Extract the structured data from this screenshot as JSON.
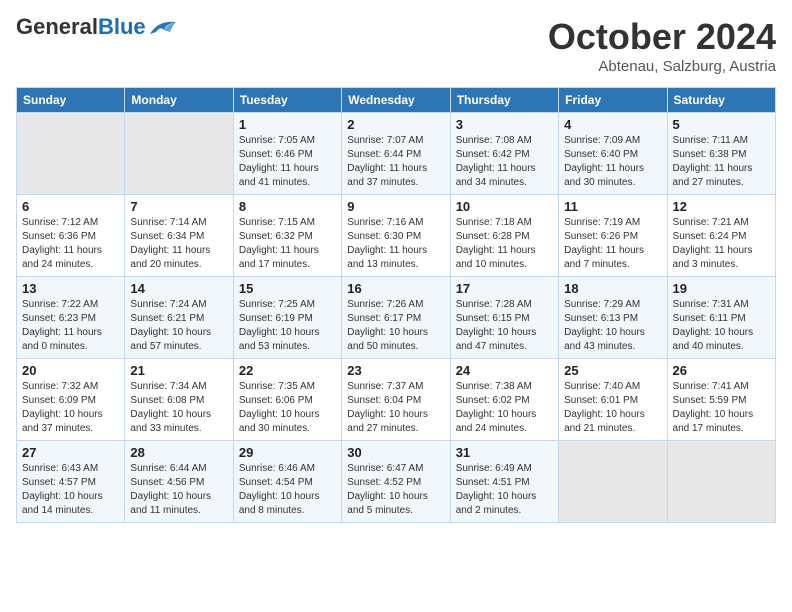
{
  "header": {
    "logo_general": "General",
    "logo_blue": "Blue",
    "title": "October 2024",
    "subtitle": "Abtenau, Salzburg, Austria"
  },
  "weekdays": [
    "Sunday",
    "Monday",
    "Tuesday",
    "Wednesday",
    "Thursday",
    "Friday",
    "Saturday"
  ],
  "weeks": [
    [
      {
        "day": "",
        "info": ""
      },
      {
        "day": "",
        "info": ""
      },
      {
        "day": "1",
        "info": "Sunrise: 7:05 AM\nSunset: 6:46 PM\nDaylight: 11 hours and 41 minutes."
      },
      {
        "day": "2",
        "info": "Sunrise: 7:07 AM\nSunset: 6:44 PM\nDaylight: 11 hours and 37 minutes."
      },
      {
        "day": "3",
        "info": "Sunrise: 7:08 AM\nSunset: 6:42 PM\nDaylight: 11 hours and 34 minutes."
      },
      {
        "day": "4",
        "info": "Sunrise: 7:09 AM\nSunset: 6:40 PM\nDaylight: 11 hours and 30 minutes."
      },
      {
        "day": "5",
        "info": "Sunrise: 7:11 AM\nSunset: 6:38 PM\nDaylight: 11 hours and 27 minutes."
      }
    ],
    [
      {
        "day": "6",
        "info": "Sunrise: 7:12 AM\nSunset: 6:36 PM\nDaylight: 11 hours and 24 minutes."
      },
      {
        "day": "7",
        "info": "Sunrise: 7:14 AM\nSunset: 6:34 PM\nDaylight: 11 hours and 20 minutes."
      },
      {
        "day": "8",
        "info": "Sunrise: 7:15 AM\nSunset: 6:32 PM\nDaylight: 11 hours and 17 minutes."
      },
      {
        "day": "9",
        "info": "Sunrise: 7:16 AM\nSunset: 6:30 PM\nDaylight: 11 hours and 13 minutes."
      },
      {
        "day": "10",
        "info": "Sunrise: 7:18 AM\nSunset: 6:28 PM\nDaylight: 11 hours and 10 minutes."
      },
      {
        "day": "11",
        "info": "Sunrise: 7:19 AM\nSunset: 6:26 PM\nDaylight: 11 hours and 7 minutes."
      },
      {
        "day": "12",
        "info": "Sunrise: 7:21 AM\nSunset: 6:24 PM\nDaylight: 11 hours and 3 minutes."
      }
    ],
    [
      {
        "day": "13",
        "info": "Sunrise: 7:22 AM\nSunset: 6:23 PM\nDaylight: 11 hours and 0 minutes."
      },
      {
        "day": "14",
        "info": "Sunrise: 7:24 AM\nSunset: 6:21 PM\nDaylight: 10 hours and 57 minutes."
      },
      {
        "day": "15",
        "info": "Sunrise: 7:25 AM\nSunset: 6:19 PM\nDaylight: 10 hours and 53 minutes."
      },
      {
        "day": "16",
        "info": "Sunrise: 7:26 AM\nSunset: 6:17 PM\nDaylight: 10 hours and 50 minutes."
      },
      {
        "day": "17",
        "info": "Sunrise: 7:28 AM\nSunset: 6:15 PM\nDaylight: 10 hours and 47 minutes."
      },
      {
        "day": "18",
        "info": "Sunrise: 7:29 AM\nSunset: 6:13 PM\nDaylight: 10 hours and 43 minutes."
      },
      {
        "day": "19",
        "info": "Sunrise: 7:31 AM\nSunset: 6:11 PM\nDaylight: 10 hours and 40 minutes."
      }
    ],
    [
      {
        "day": "20",
        "info": "Sunrise: 7:32 AM\nSunset: 6:09 PM\nDaylight: 10 hours and 37 minutes."
      },
      {
        "day": "21",
        "info": "Sunrise: 7:34 AM\nSunset: 6:08 PM\nDaylight: 10 hours and 33 minutes."
      },
      {
        "day": "22",
        "info": "Sunrise: 7:35 AM\nSunset: 6:06 PM\nDaylight: 10 hours and 30 minutes."
      },
      {
        "day": "23",
        "info": "Sunrise: 7:37 AM\nSunset: 6:04 PM\nDaylight: 10 hours and 27 minutes."
      },
      {
        "day": "24",
        "info": "Sunrise: 7:38 AM\nSunset: 6:02 PM\nDaylight: 10 hours and 24 minutes."
      },
      {
        "day": "25",
        "info": "Sunrise: 7:40 AM\nSunset: 6:01 PM\nDaylight: 10 hours and 21 minutes."
      },
      {
        "day": "26",
        "info": "Sunrise: 7:41 AM\nSunset: 5:59 PM\nDaylight: 10 hours and 17 minutes."
      }
    ],
    [
      {
        "day": "27",
        "info": "Sunrise: 6:43 AM\nSunset: 4:57 PM\nDaylight: 10 hours and 14 minutes."
      },
      {
        "day": "28",
        "info": "Sunrise: 6:44 AM\nSunset: 4:56 PM\nDaylight: 10 hours and 11 minutes."
      },
      {
        "day": "29",
        "info": "Sunrise: 6:46 AM\nSunset: 4:54 PM\nDaylight: 10 hours and 8 minutes."
      },
      {
        "day": "30",
        "info": "Sunrise: 6:47 AM\nSunset: 4:52 PM\nDaylight: 10 hours and 5 minutes."
      },
      {
        "day": "31",
        "info": "Sunrise: 6:49 AM\nSunset: 4:51 PM\nDaylight: 10 hours and 2 minutes."
      },
      {
        "day": "",
        "info": ""
      },
      {
        "day": "",
        "info": ""
      }
    ]
  ]
}
